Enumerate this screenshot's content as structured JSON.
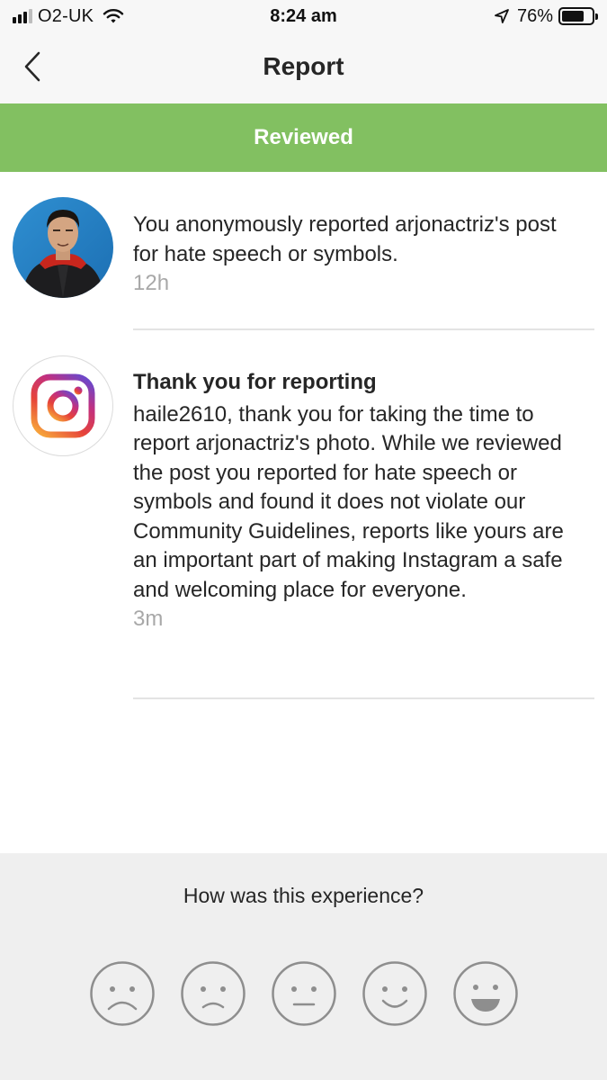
{
  "status_bar": {
    "carrier": "O2-UK",
    "time": "8:24 am",
    "battery_percent": "76%",
    "battery_level": 0.76,
    "signal_bars_filled": 3,
    "signal_bars_total": 4,
    "icons": [
      "signal-icon",
      "wifi-icon",
      "location-arrow-icon",
      "battery-icon"
    ]
  },
  "nav": {
    "title": "Report",
    "back_icon": "chevron-left-icon"
  },
  "banner": {
    "status": "Reviewed",
    "color": "#82c061"
  },
  "items": [
    {
      "avatar": "user-profile-photo",
      "text": "You anonymously reported arjonactriz's post for hate speech or symbols.",
      "time": "12h"
    },
    {
      "avatar": "instagram-logo-icon",
      "heading": "Thank you for reporting",
      "text": "haile2610, thank you for taking the time to report arjonactriz's photo. While we reviewed the post you reported for hate speech or symbols and found it does not violate our Community Guidelines, reports like yours are an important part of making Instagram a safe and welcoming place for everyone.",
      "time": "3m"
    }
  ],
  "feedback": {
    "question": "How was this experience?",
    "ratings": [
      "very-sad-face-icon",
      "sad-face-icon",
      "neutral-face-icon",
      "smile-face-icon",
      "grin-face-icon"
    ]
  },
  "colors": {
    "banner_green": "#82c061",
    "secondary_text": "#a8a8a8",
    "feedback_bg": "#efefef",
    "face_stroke": "#8e8e8e"
  }
}
